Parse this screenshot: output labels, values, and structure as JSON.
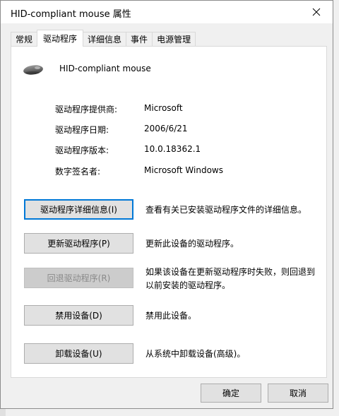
{
  "window": {
    "title": "HID-compliant mouse 属性"
  },
  "tabs": [
    {
      "label": "常规"
    },
    {
      "label": "驱动程序"
    },
    {
      "label": "详细信息"
    },
    {
      "label": "事件"
    },
    {
      "label": "电源管理"
    }
  ],
  "active_tab": "驱动程序",
  "device": {
    "name": "HID-compliant mouse",
    "icon": "mouse-icon"
  },
  "info": [
    {
      "label": "驱动程序提供商:",
      "value": "Microsoft"
    },
    {
      "label": "驱动程序日期:",
      "value": "2006/6/21"
    },
    {
      "label": "驱动程序版本:",
      "value": "10.0.18362.1"
    },
    {
      "label": "数字签名者:",
      "value": "Microsoft Windows"
    }
  ],
  "actions": [
    {
      "label": "驱动程序详细信息(I)",
      "description": "查看有关已安装驱动程序文件的详细信息。",
      "enabled": true
    },
    {
      "label": "更新驱动程序(P)",
      "description": "更新此设备的驱动程序。",
      "enabled": true
    },
    {
      "label": "回退驱动程序(R)",
      "description": "如果该设备在更新驱动程序时失败，则回退到以前安装的驱动程序。",
      "enabled": false
    },
    {
      "label": "禁用设备(D)",
      "description": "禁用此设备。",
      "enabled": true
    },
    {
      "label": "卸载设备(U)",
      "description": "从系统中卸载设备(高级)。",
      "enabled": true
    }
  ],
  "footer": {
    "ok_label": "确定",
    "cancel_label": "取消"
  },
  "colors": {
    "focus": "#0078d7",
    "button_face": "#e1e1e1",
    "panel": "#ffffff",
    "window": "#f0f0f0"
  }
}
